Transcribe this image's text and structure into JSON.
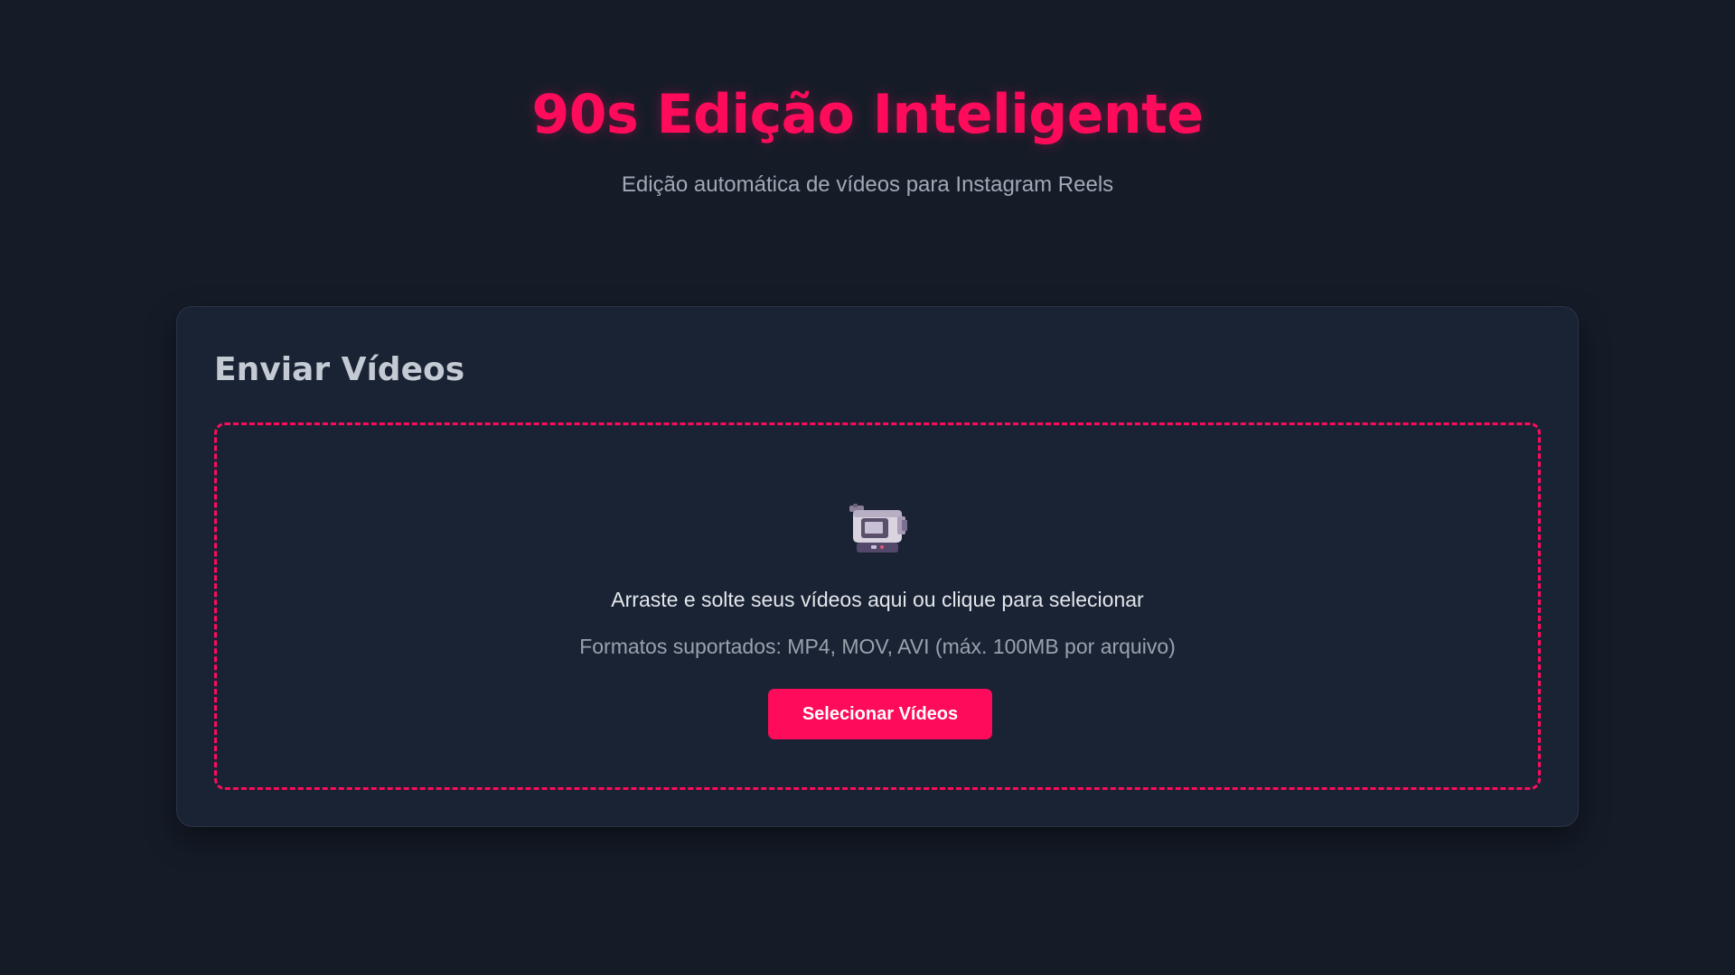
{
  "header": {
    "title": "90s Edição Inteligente",
    "subtitle": "Edição automática de vídeos para Instagram Reels"
  },
  "upload_card": {
    "title": "Enviar Vídeos",
    "dropzone": {
      "icon": "video-camera-icon",
      "instruction": "Arraste e solte seus vídeos aqui ou clique para selecionar",
      "formats": "Formatos suportados: MP4, MOV, AVI (máx. 100MB por arquivo)",
      "button_label": "Selecionar Vídeos"
    }
  },
  "colors": {
    "accent": "#ff0b5b",
    "background": "#151c28",
    "card": "#1a2334"
  }
}
